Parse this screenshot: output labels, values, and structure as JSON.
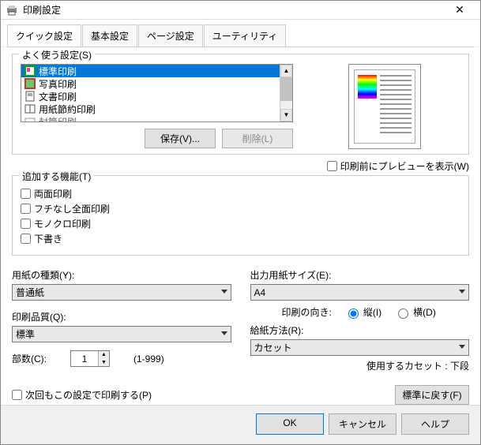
{
  "window": {
    "title": "印刷設定"
  },
  "tabs": {
    "t0": "クイック設定",
    "t1": "基本設定",
    "t2": "ページ設定",
    "t3": "ユーティリティ"
  },
  "presets": {
    "legend": "よく使う設定(S)",
    "items": {
      "i0": "標準印刷",
      "i1": "写真印刷",
      "i2": "文書印刷",
      "i3": "用紙節約印刷",
      "i4": "封筒印刷"
    },
    "save": "保存(V)...",
    "delete": "削除(L)"
  },
  "preview_chk": "印刷前にプレビューを表示(W)",
  "addfunc": {
    "legend": "追加する機能(T)",
    "c0": "両面印刷",
    "c1": "フチなし全面印刷",
    "c2": "モノクロ印刷",
    "c3": "下書き"
  },
  "left": {
    "papertype_label": "用紙の種類(Y):",
    "papertype_value": "普通紙",
    "quality_label": "印刷品質(Q):",
    "quality_value": "標準",
    "copies_label": "部数(C):",
    "copies_value": "1",
    "copies_range": "(1-999)"
  },
  "right": {
    "outsize_label": "出力用紙サイズ(E):",
    "outsize_value": "A4",
    "orient_label": "印刷の向き:",
    "orient_p": "縦(I)",
    "orient_l": "横(D)",
    "source_label": "給紙方法(R):",
    "source_value": "カセット",
    "cassette": "使用するカセット : 下段"
  },
  "always": "次回もこの設定で印刷する(P)",
  "defaults": "標準に戻す(F)",
  "buttons": {
    "ok": "OK",
    "cancel": "キャンセル",
    "help": "ヘルプ"
  }
}
